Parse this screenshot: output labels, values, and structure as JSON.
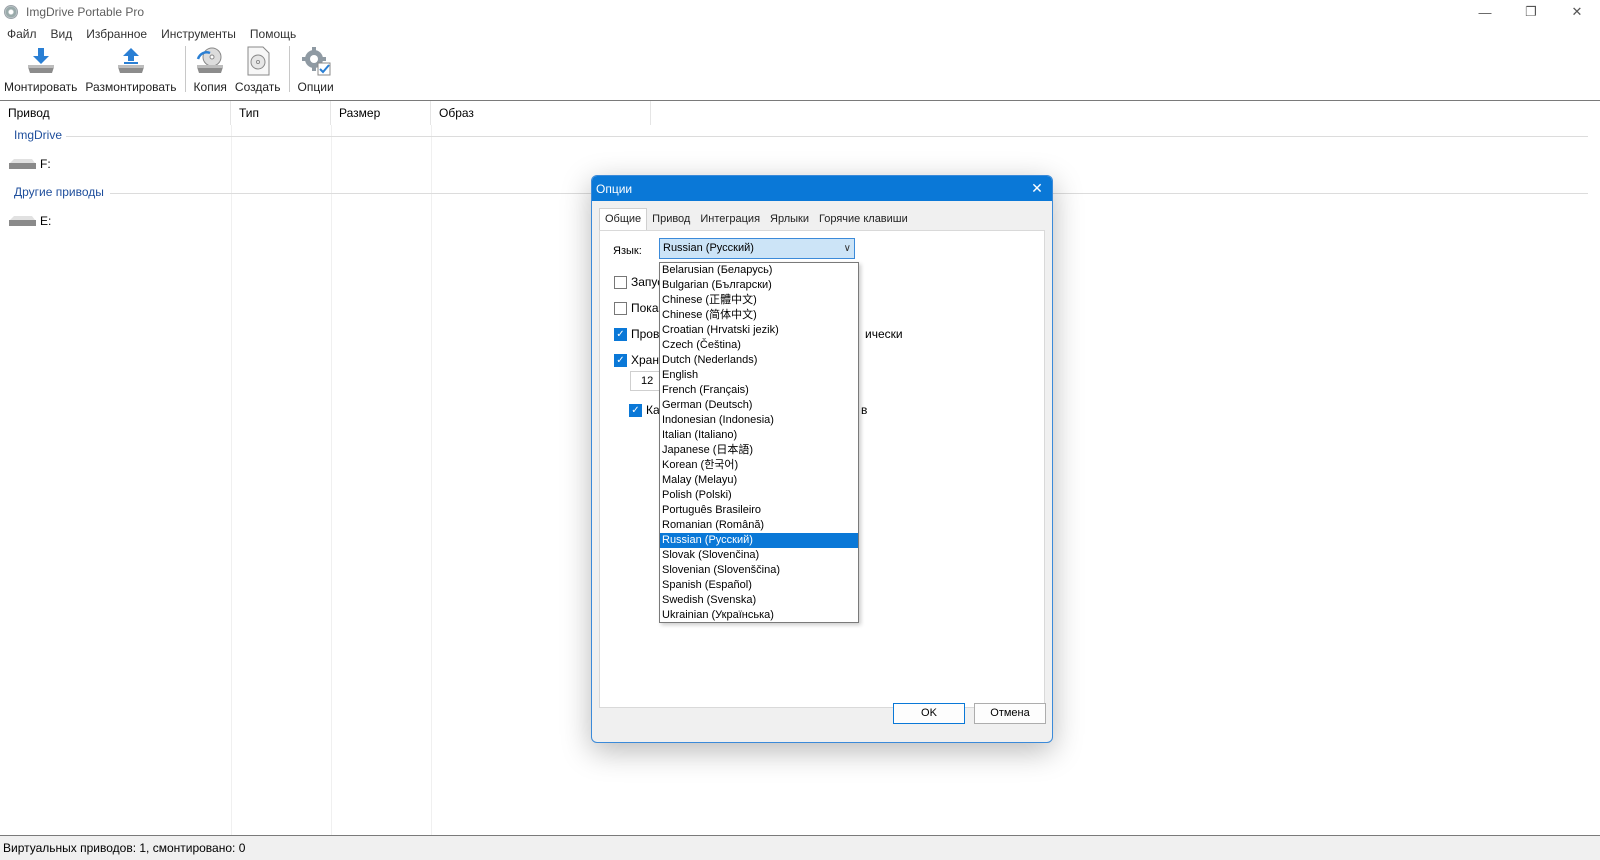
{
  "window": {
    "title": "ImgDrive Portable Pro",
    "minimize": "—",
    "restore": "❐",
    "close": "✕"
  },
  "menu": [
    "Файл",
    "Вид",
    "Избранное",
    "Инструменты",
    "Помощь"
  ],
  "toolbar": {
    "mount": "Монтировать",
    "unmount": "Размонтировать",
    "copy": "Копия",
    "create": "Создать",
    "options": "Опции"
  },
  "list": {
    "columns": [
      "Привод",
      "Тип",
      "Размер",
      "Образ"
    ],
    "groups": [
      {
        "name": "ImgDrive",
        "drive": "F:"
      },
      {
        "name": "Другие приводы",
        "drive": "E:"
      }
    ]
  },
  "status": "Виртуальных приводов: 1, смонтировано: 0",
  "dialog": {
    "title": "Опции",
    "close": "✕",
    "tabs": [
      "Общие",
      "Привод",
      "Интеграция",
      "Ярлыки",
      "Горячие клавиши"
    ],
    "language_label": "Язык:",
    "language_value": "Russian (Русский)",
    "fragments": {
      "cb1": "Запус",
      "cb2": "Показ",
      "cb3": "Пров",
      "cb3_tail": "ически",
      "cb4": "Хран",
      "spin_value": "12",
      "cb5": "Ка",
      "cb5_tail": "в"
    },
    "ok": "OK",
    "cancel": "Отмена",
    "languages": [
      "Belarusian (Беларусь)",
      "Bulgarian (Български)",
      "Chinese (正體中文)",
      "Chinese (简体中文)",
      "Croatian (Hrvatski jezik)",
      "Czech (Čeština)",
      "Dutch (Nederlands)",
      "English",
      "French (Français)",
      "German (Deutsch)",
      "Indonesian (Indonesia)",
      "Italian (Italiano)",
      "Japanese (日本語)",
      "Korean (한국어)",
      "Malay (Melayu)",
      "Polish (Polski)",
      "Português Brasileiro",
      "Romanian (Română)",
      "Russian (Русский)",
      "Slovak (Slovenčina)",
      "Slovenian (Slovenščina)",
      "Spanish (Español)",
      "Swedish (Svenska)",
      "Ukrainian (Українська)"
    ],
    "selected_language_index": 18
  }
}
